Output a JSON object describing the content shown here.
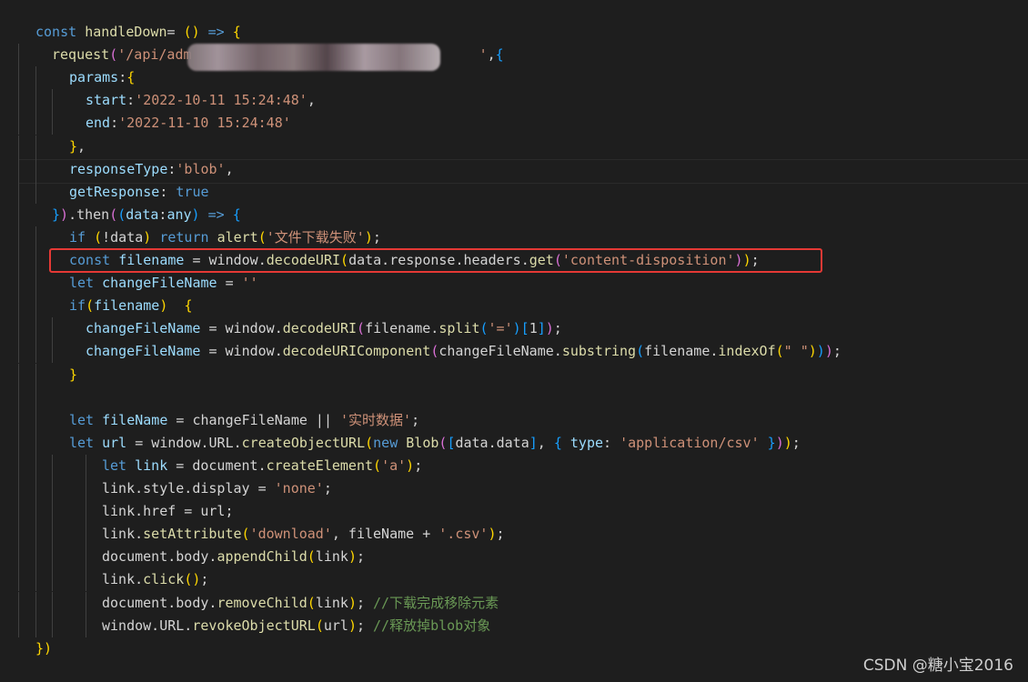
{
  "watermark": "CSDN @糖小宝2016",
  "colors": {
    "background": "#1e1e1e",
    "keyword": "#569cd6",
    "function": "#dcdcaa",
    "string": "#ce9178",
    "variable": "#9cdcfe",
    "comment": "#6a9955",
    "highlight_box": "#e53935"
  },
  "code_lines": [
    [
      [
        "kw",
        "const "
      ],
      [
        "fn",
        "handleDown"
      ],
      [
        "",
        "= "
      ],
      [
        "b1",
        "()"
      ],
      [
        "kw",
        " => "
      ],
      [
        "b1",
        "{"
      ]
    ],
    [
      [
        "fn",
        "request"
      ],
      [
        "b2",
        "("
      ],
      [
        "str",
        "'/api/adm"
      ],
      [
        "",
        "                                   "
      ],
      [
        "str",
        "'"
      ],
      [
        "",
        ","
      ],
      [
        "b3",
        "{"
      ]
    ],
    [
      [
        "var",
        "params"
      ],
      [
        "",
        ":"
      ],
      [
        "b1",
        "{"
      ]
    ],
    [
      [
        "var",
        "start"
      ],
      [
        "",
        ":"
      ],
      [
        "str",
        "'2022-10-11 15:24:48'"
      ],
      [
        "",
        ","
      ]
    ],
    [
      [
        "var",
        "end"
      ],
      [
        "",
        ":"
      ],
      [
        "str",
        "'2022-11-10 15:24:48'"
      ]
    ],
    [
      [
        "b1",
        "}"
      ],
      [
        "",
        ","
      ]
    ],
    [
      [
        "var",
        "responseType"
      ],
      [
        "",
        ":"
      ],
      [
        "str",
        "'blob'"
      ],
      [
        "",
        ","
      ]
    ],
    [
      [
        "var",
        "getResponse"
      ],
      [
        "",
        ": "
      ],
      [
        "kw",
        "true"
      ]
    ],
    [
      [
        "b3",
        "}"
      ],
      [
        "b2",
        ")"
      ],
      [
        "",
        ".then"
      ],
      [
        "b2",
        "("
      ],
      [
        "b3",
        "("
      ],
      [
        "var",
        "data"
      ],
      [
        "",
        ":"
      ],
      [
        "var",
        "any"
      ],
      [
        "b3",
        ")"
      ],
      [
        "kw",
        " => "
      ],
      [
        "b3",
        "{"
      ]
    ],
    [
      [
        "kw",
        "if "
      ],
      [
        "b1",
        "("
      ],
      [
        "",
        "!data"
      ],
      [
        "b1",
        ")"
      ],
      [
        "kw",
        " return "
      ],
      [
        "fn",
        "alert"
      ],
      [
        "b1",
        "("
      ],
      [
        "str",
        "'文件下载失败'"
      ],
      [
        "b1",
        ")"
      ],
      [
        "",
        ";"
      ]
    ],
    [
      [
        "kw",
        "const "
      ],
      [
        "var",
        "filename "
      ],
      [
        "",
        "= window."
      ],
      [
        "fn",
        "decodeURI"
      ],
      [
        "b1",
        "("
      ],
      [
        "",
        "data.response.headers."
      ],
      [
        "fn",
        "get"
      ],
      [
        "b2",
        "("
      ],
      [
        "str",
        "'content-disposition'"
      ],
      [
        "b2",
        ")"
      ],
      [
        "b1",
        ")"
      ],
      [
        "",
        ";"
      ]
    ],
    [
      [
        "kw",
        "let "
      ],
      [
        "var",
        "changeFileName "
      ],
      [
        "",
        "= "
      ],
      [
        "str",
        "''"
      ]
    ],
    [
      [
        "kw",
        "if"
      ],
      [
        "b1",
        "("
      ],
      [
        "var",
        "filename"
      ],
      [
        "b1",
        ")"
      ],
      [
        "",
        "  "
      ],
      [
        "b1",
        "{"
      ]
    ],
    [
      [
        "var",
        "changeFileName "
      ],
      [
        "",
        "= window."
      ],
      [
        "fn",
        "decodeURI"
      ],
      [
        "b2",
        "("
      ],
      [
        "",
        "filename."
      ],
      [
        "fn",
        "split"
      ],
      [
        "b3",
        "("
      ],
      [
        "str",
        "'='"
      ],
      [
        "b3",
        ")"
      ],
      [
        "b3",
        "["
      ],
      [
        "",
        "1"
      ],
      [
        "b3",
        "]"
      ],
      [
        "b2",
        ")"
      ],
      [
        "",
        ";"
      ]
    ],
    [
      [
        "var",
        "changeFileName "
      ],
      [
        "",
        "= window."
      ],
      [
        "fn",
        "decodeURIComponent"
      ],
      [
        "b2",
        "("
      ],
      [
        "",
        "changeFileName."
      ],
      [
        "fn",
        "substring"
      ],
      [
        "b3",
        "("
      ],
      [
        "",
        "filename."
      ],
      [
        "fn",
        "indexOf"
      ],
      [
        "b1",
        "("
      ],
      [
        "str",
        "\" \""
      ],
      [
        "b1",
        ")"
      ],
      [
        "b3",
        ")"
      ],
      [
        "b2",
        ")"
      ],
      [
        "",
        ";"
      ]
    ],
    [
      [
        "b1",
        "}"
      ]
    ],
    [],
    [
      [
        "kw",
        "let "
      ],
      [
        "var",
        "fileName "
      ],
      [
        "",
        "= changeFileName || "
      ],
      [
        "str",
        "'实时数据'"
      ],
      [
        "",
        ";"
      ]
    ],
    [
      [
        "kw",
        "let "
      ],
      [
        "var",
        "url "
      ],
      [
        "",
        "= window.URL."
      ],
      [
        "fn",
        "createObjectURL"
      ],
      [
        "b1",
        "("
      ],
      [
        "kw",
        "new "
      ],
      [
        "fn",
        "Blob"
      ],
      [
        "b2",
        "("
      ],
      [
        "b3",
        "["
      ],
      [
        "",
        "data.data"
      ],
      [
        "b3",
        "]"
      ],
      [
        "",
        ", "
      ],
      [
        "b3",
        "{ "
      ],
      [
        "var",
        "type"
      ],
      [
        "",
        ": "
      ],
      [
        "str",
        "'application/csv'"
      ],
      [
        "b3",
        " }"
      ],
      [
        "b2",
        ")"
      ],
      [
        "b1",
        ")"
      ],
      [
        "",
        ";"
      ]
    ],
    [
      [
        "kw",
        "let "
      ],
      [
        "var",
        "link "
      ],
      [
        "",
        "= document."
      ],
      [
        "fn",
        "createElement"
      ],
      [
        "b1",
        "("
      ],
      [
        "str",
        "'a'"
      ],
      [
        "b1",
        ")"
      ],
      [
        "",
        ";"
      ]
    ],
    [
      [
        "",
        "link.style.display = "
      ],
      [
        "str",
        "'none'"
      ],
      [
        "",
        ";"
      ]
    ],
    [
      [
        "",
        "link.href = url;"
      ]
    ],
    [
      [
        "",
        "link."
      ],
      [
        "fn",
        "setAttribute"
      ],
      [
        "b1",
        "("
      ],
      [
        "str",
        "'download'"
      ],
      [
        "",
        ", fileName + "
      ],
      [
        "str",
        "'.csv'"
      ],
      [
        "b1",
        ")"
      ],
      [
        "",
        ";"
      ]
    ],
    [
      [
        "",
        "document.body."
      ],
      [
        "fn",
        "appendChild"
      ],
      [
        "b1",
        "("
      ],
      [
        "",
        "link"
      ],
      [
        "b1",
        ")"
      ],
      [
        "",
        ";"
      ]
    ],
    [
      [
        "",
        "link."
      ],
      [
        "fn",
        "click"
      ],
      [
        "b1",
        "()"
      ],
      [
        "",
        ";"
      ]
    ],
    [
      [
        "",
        "document.body."
      ],
      [
        "fn",
        "removeChild"
      ],
      [
        "b1",
        "("
      ],
      [
        "",
        "link"
      ],
      [
        "b1",
        ")"
      ],
      [
        "",
        "; "
      ],
      [
        "cm",
        "//下载完成移除元素"
      ]
    ],
    [
      [
        "",
        "window.URL."
      ],
      [
        "fn",
        "revokeObjectURL"
      ],
      [
        "b1",
        "("
      ],
      [
        "",
        "url"
      ],
      [
        "b1",
        ")"
      ],
      [
        "",
        "; "
      ],
      [
        "cm",
        "//释放掉blob对象"
      ]
    ],
    [
      [
        "b1",
        "})"
      ]
    ]
  ]
}
